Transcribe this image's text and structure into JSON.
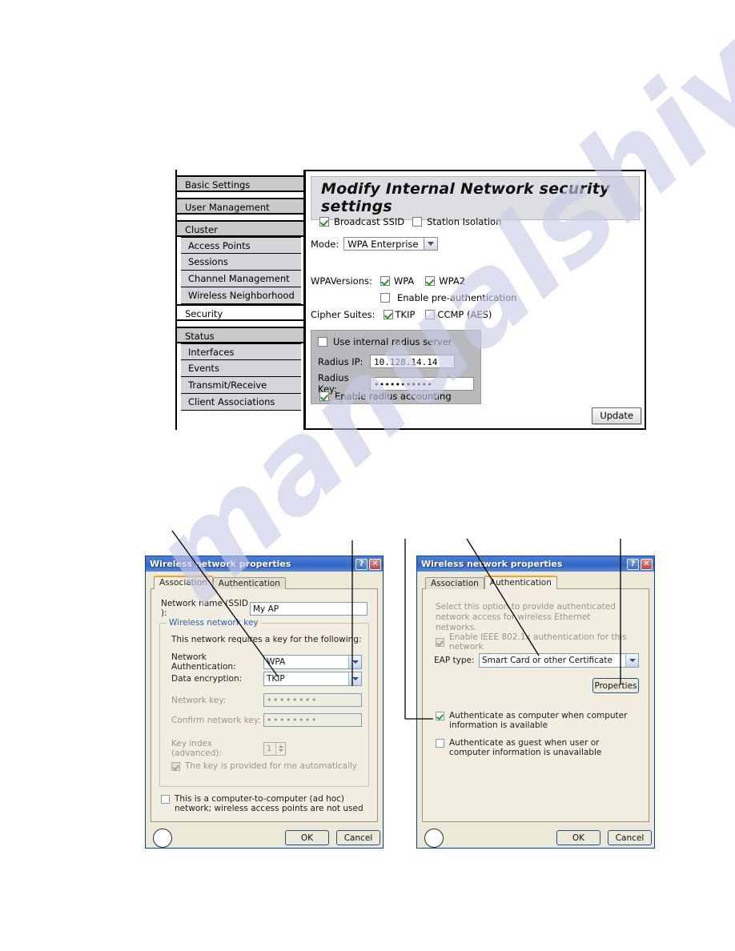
{
  "page": {
    "watermark": "manualshive.com"
  },
  "admin_panel": {
    "heading": "Modify Internal Network security settings",
    "sidebar": [
      {
        "label": "Basic Settings",
        "level": "top",
        "active": false
      },
      {
        "label": "User Management",
        "level": "top",
        "active": false
      },
      {
        "label": "Cluster",
        "level": "top",
        "active": false
      },
      {
        "label": "Access Points",
        "level": "sub",
        "active": false
      },
      {
        "label": "Sessions",
        "level": "sub",
        "active": false
      },
      {
        "label": "Channel Management",
        "level": "sub",
        "active": false
      },
      {
        "label": "Wireless Neighborhood",
        "level": "sub",
        "active": false
      },
      {
        "label": "Security",
        "level": "top",
        "active": true
      },
      {
        "label": "Status",
        "level": "top",
        "active": false
      },
      {
        "label": "Interfaces",
        "level": "sub",
        "active": false
      },
      {
        "label": "Events",
        "level": "sub",
        "active": false
      },
      {
        "label": "Transmit/Receive",
        "level": "sub",
        "active": false
      },
      {
        "label": "Client Associations",
        "level": "sub",
        "active": false
      }
    ],
    "broadcast_ssid": {
      "label": "Broadcast SSID",
      "checked": true
    },
    "station_isolation": {
      "label": "Station Isolation",
      "checked": false
    },
    "mode": {
      "label": "Mode:",
      "value": "WPA Enterprise"
    },
    "wpa_versions": {
      "label": "WPAVersions:",
      "wpa": {
        "label": "WPA",
        "checked": true
      },
      "wpa2": {
        "label": "WPA2",
        "checked": true
      },
      "pre_auth": {
        "label": "Enable pre-authentication",
        "checked": false
      }
    },
    "cipher_suites": {
      "label": "Cipher Suites:",
      "tkip": {
        "label": "TKIP",
        "checked": true
      },
      "ccmp": {
        "label": "CCMP (AES)",
        "checked": false
      }
    },
    "radius": {
      "use_internal": {
        "label": "Use internal radius server",
        "checked": false
      },
      "ip_label": "Radius IP:",
      "ip_value": "10.128.14.14",
      "key_label": "Radius Key:",
      "key_value": "•••••••••••",
      "accounting": {
        "label": "Enable radius accounting",
        "checked": true
      }
    },
    "update_button": "Update"
  },
  "dialog_association": {
    "title": "Wireless network properties",
    "help_button": "?",
    "close_button": "✕",
    "tabs": [
      {
        "label": "Association",
        "active": true
      },
      {
        "label": "Authentication",
        "active": false
      }
    ],
    "ssid_label": "Network name (SSID ):",
    "ssid_value": "My AP",
    "group_title": "Wireless network key",
    "requires_key_text": "This network requires a key for the following:",
    "network_auth_label": "Network Authentication:",
    "network_auth_value": "WPA",
    "data_encryption_label": "Data encryption:",
    "data_encryption_value": "TKIP",
    "network_key_label": "Network key:",
    "network_key_value": "••••••••",
    "confirm_key_label": "Confirm network key:",
    "confirm_key_value": "••••••••",
    "key_index_label": "Key index (advanced):",
    "key_index_value": "1",
    "key_auto_label": "The key is provided for me automatically",
    "key_auto_checked": true,
    "adhoc_label": "This is a computer-to-computer (ad hoc) network; wireless access points are not used",
    "adhoc_checked": false,
    "ok_button": "OK",
    "cancel_button": "Cancel"
  },
  "dialog_authentication": {
    "title": "Wireless network properties",
    "help_button": "?",
    "close_button": "✕",
    "tabs": [
      {
        "label": "Association",
        "active": false
      },
      {
        "label": "Authentication",
        "active": true
      }
    ],
    "description": "Select this option to provide authenticated network access for wireless Ethernet networks.",
    "enable_8021x_label": "Enable IEEE 802.1x authentication for this network",
    "enable_8021x_checked": true,
    "eap_type_label": "EAP type:",
    "eap_type_value": "Smart Card or other Certificate",
    "properties_button": "Properties",
    "auth_computer_label": "Authenticate as computer when computer information is available",
    "auth_computer_checked": true,
    "auth_guest_label": "Authenticate as guest when user or computer information is unavailable",
    "auth_guest_checked": false,
    "ok_button": "OK",
    "cancel_button": "Cancel"
  }
}
